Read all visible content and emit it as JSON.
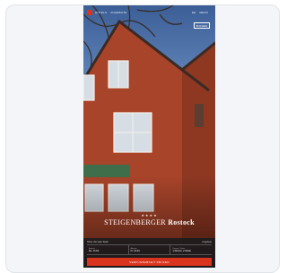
{
  "preview": {
    "nav_left": [
      "HOTELS",
      "ANGEBOTE"
    ],
    "nav_right": [
      "DE",
      "MENÜ"
    ],
    "book_label": "BUCHEN"
  },
  "hotel": {
    "stars": "★★★★",
    "brand": "STEIGENBERGER",
    "city": "Rostock"
  },
  "booking": {
    "head_left": "Hotel, Ziel oder Stadt",
    "head_right": "Angebote",
    "fields": [
      {
        "label": "Anreise",
        "value": "Do. 13.04."
      },
      {
        "label": "Abreise",
        "value": "Fr. 14.04."
      },
      {
        "label": "Zimmer / Gäste",
        "value": "1 Zimmer, 2 Gäste"
      }
    ],
    "search_label": "VERFÜGBARKEIT PRÜFEN"
  },
  "colors": {
    "accent": "#d9341e",
    "facade": "#a8442a",
    "panel": "#1a1a1e"
  }
}
